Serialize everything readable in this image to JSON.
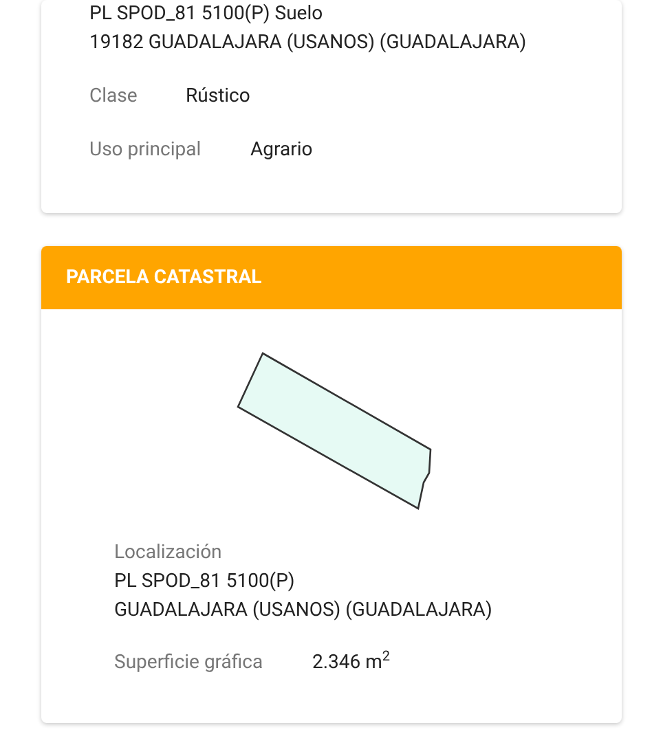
{
  "suelo_card": {
    "address_lines": [
      "PL SPOD_81 5100(P) Suelo",
      "19182 GUADALAJARA (USANOS) (GUADALAJARA)"
    ],
    "fields": [
      {
        "label": "Clase",
        "value": "Rústico"
      },
      {
        "label": "Uso principal",
        "value": "Agrario"
      }
    ]
  },
  "parcela_card": {
    "title": "PARCELA CATASTRAL",
    "localizacion": {
      "label": "Localización",
      "lines": [
        "PL SPOD_81 5100(P)",
        "GUADALAJARA (USANOS) (GUADALAJARA)"
      ]
    },
    "superficie": {
      "label": "Superficie gráfica",
      "value": "2.346 m$^{2}$"
    }
  }
}
